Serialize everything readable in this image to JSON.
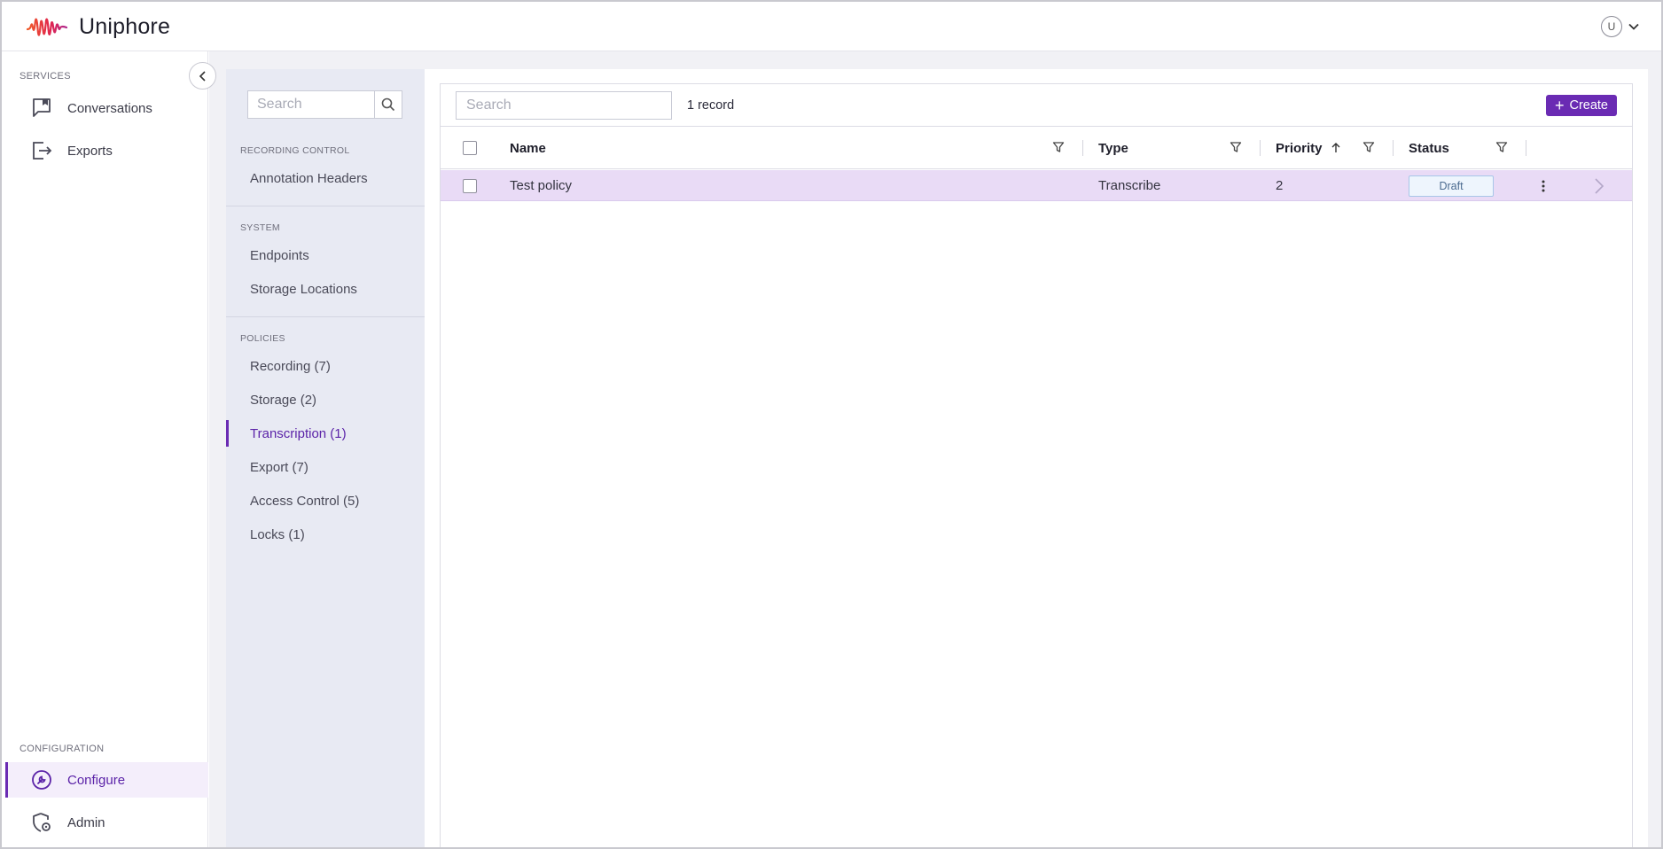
{
  "app": {
    "name": "Uniphore"
  },
  "user": {
    "initial": "U"
  },
  "leftnav": {
    "services_label": "SERVICES",
    "services": [
      {
        "label": "Conversations",
        "icon": "conversations-icon"
      },
      {
        "label": "Exports",
        "icon": "exports-icon"
      }
    ],
    "configuration_label": "CONFIGURATION",
    "configuration": [
      {
        "label": "Configure",
        "icon": "wrench-icon",
        "active": true
      },
      {
        "label": "Admin",
        "icon": "shield-gear-icon"
      }
    ]
  },
  "config_sidebar": {
    "search_placeholder": "Search",
    "sections": [
      {
        "label": "RECORDING CONTROL",
        "items": [
          "Annotation Headers"
        ]
      },
      {
        "label": "SYSTEM",
        "items": [
          "Endpoints",
          "Storage Locations"
        ]
      },
      {
        "label": "POLICIES",
        "items": [
          "Recording (7)",
          "Storage (2)",
          "Transcription (1)",
          "Export (7)",
          "Access Control (5)",
          "Locks (1)"
        ]
      }
    ],
    "active_item": "Transcription (1)"
  },
  "toolbar": {
    "search_placeholder": "Search",
    "record_count": "1 record",
    "create_label": "Create"
  },
  "table": {
    "columns": [
      {
        "label": "Name"
      },
      {
        "label": "Type"
      },
      {
        "label": "Priority",
        "sort": "ascending"
      },
      {
        "label": "Status"
      }
    ],
    "rows": [
      {
        "name": "Test policy",
        "type": "Transcribe",
        "priority": "2",
        "status": "Draft"
      }
    ]
  },
  "colors": {
    "accent": "#6a2bb3",
    "row_selected": "#e9dbf6",
    "logo": "#e23b4e"
  }
}
